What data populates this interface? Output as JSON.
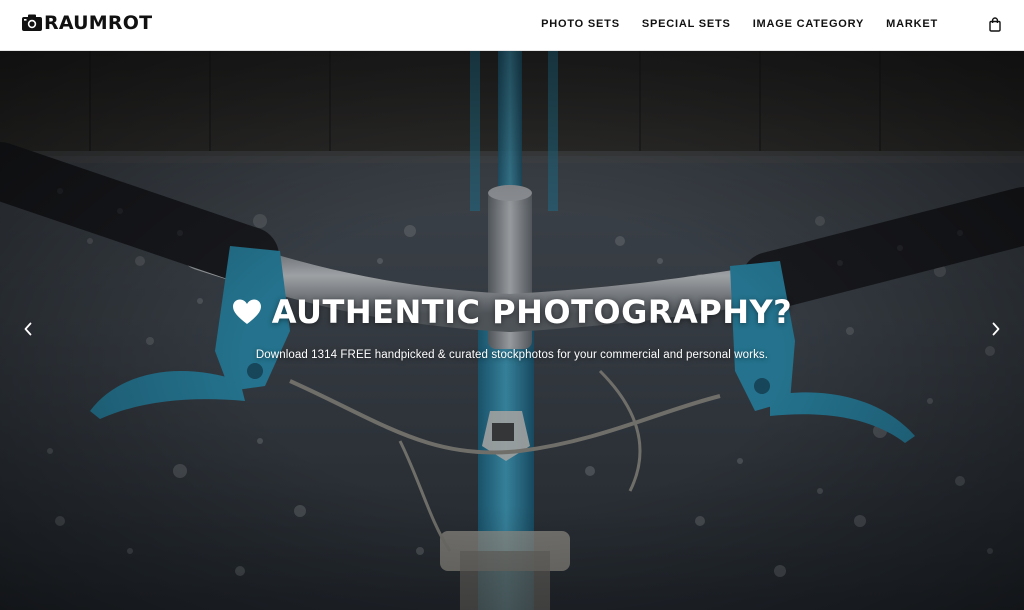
{
  "header": {
    "logo_text": "RAUMROT",
    "nav": [
      {
        "label": "PHOTO SETS"
      },
      {
        "label": "SPECIAL SETS"
      },
      {
        "label": "IMAGE CATEGORY"
      },
      {
        "label": "MARKET"
      }
    ],
    "cart_icon": "shopping-bag-icon"
  },
  "hero": {
    "title": "AUTHENTIC PHOTOGRAPHY?",
    "subtitle": "Download 1314 FREE handpicked & curated stockphotos for your commercial and personal works.",
    "title_icon": "heart-icon",
    "prev_icon": "chevron-left-icon",
    "next_icon": "chevron-right-icon",
    "accent_color": "#3fa9c9"
  }
}
